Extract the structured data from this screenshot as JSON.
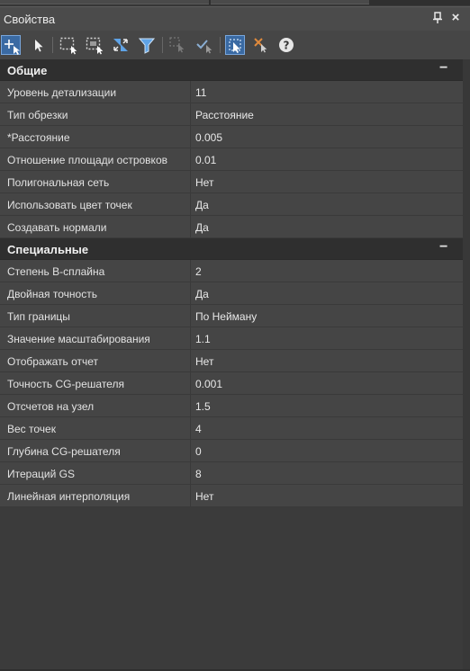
{
  "panel": {
    "title": "Свойства",
    "pin_icon": "pin-icon",
    "close_label": "×"
  },
  "toolbar": {
    "buttons": [
      {
        "name": "add-selection-icon",
        "active": true
      },
      {
        "name": "select-arrow-icon"
      },
      {
        "name": "select-rect-icon"
      },
      {
        "name": "select-window-icon"
      },
      {
        "name": "invert-selection-icon"
      },
      {
        "name": "filter-icon"
      },
      {
        "name": "deselect-icon"
      },
      {
        "name": "check-select-icon"
      },
      {
        "name": "pick-object-icon",
        "active": true
      },
      {
        "name": "clear-select-icon"
      },
      {
        "name": "help-icon"
      }
    ]
  },
  "sections": [
    {
      "title": "Общие",
      "toggle": "−",
      "rows": [
        {
          "key": "Уровень детализации",
          "value": "11"
        },
        {
          "key": "Тип обрезки",
          "value": "Расстояние"
        },
        {
          "key": "*Расстояние",
          "value": "0.005"
        },
        {
          "key": "Отношение площади островков",
          "value": "0.01"
        },
        {
          "key": "Полигональная сеть",
          "value": "Нет"
        },
        {
          "key": "Использовать цвет точек",
          "value": "Да"
        },
        {
          "key": "Создавать нормали",
          "value": "Да"
        }
      ]
    },
    {
      "title": "Специальные",
      "toggle": "−",
      "rows": [
        {
          "key": "Степень B-сплайна",
          "value": "2"
        },
        {
          "key": "Двойная точность",
          "value": "Да"
        },
        {
          "key": "Тип границы",
          "value": "По Нейману"
        },
        {
          "key": "Значение масштабирования",
          "value": "1.1"
        },
        {
          "key": "Отображать отчет",
          "value": "Нет"
        },
        {
          "key": "Точность CG-решателя",
          "value": "0.001"
        },
        {
          "key": "Отсчетов на узел",
          "value": "1.5"
        },
        {
          "key": "Вес точек",
          "value": "4"
        },
        {
          "key": "Глубина CG-решателя",
          "value": "0"
        },
        {
          "key": "Итераций GS",
          "value": "8"
        },
        {
          "key": "Линейная интерполяция",
          "value": "Нет"
        }
      ]
    }
  ],
  "colors": {
    "background": "#3b3b3b",
    "category": "#2f2f2f",
    "row": "#454545",
    "active_button": "#3a6aa3"
  }
}
